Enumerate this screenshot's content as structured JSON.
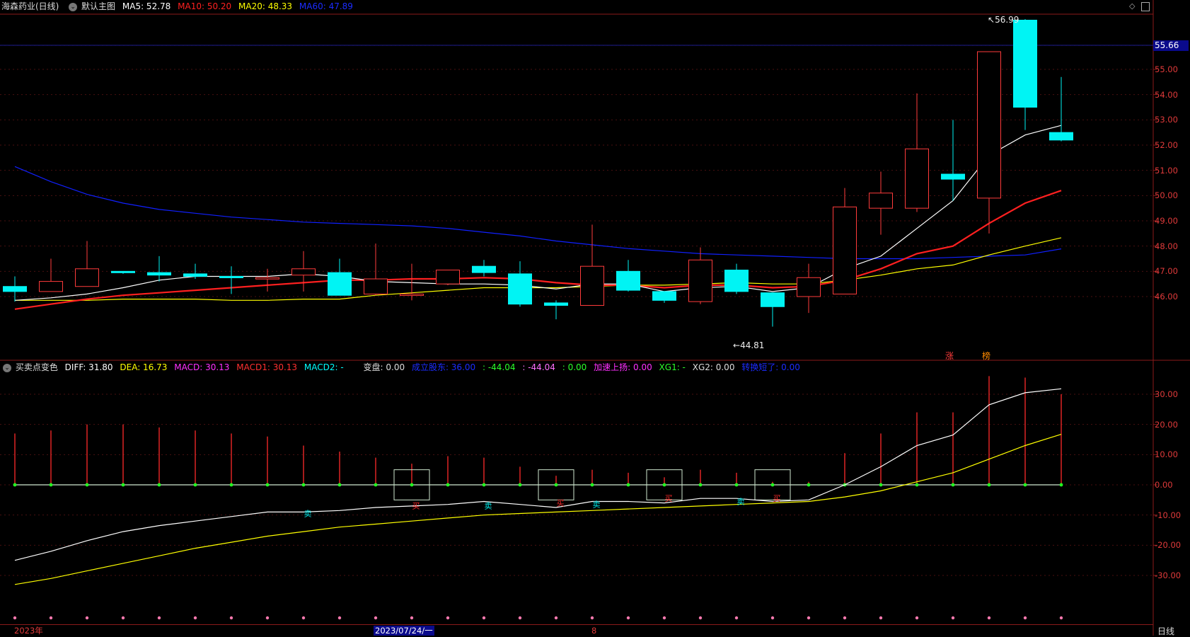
{
  "colors": {
    "up": "#ff3b3b",
    "down": "#00f4f4",
    "ma5": "#ffffff",
    "ma10": "#ff2020",
    "ma20": "#ffff00",
    "ma60": "#1020ff",
    "diff": "#ffffff",
    "dea": "#ffff00",
    "grid": "#8b1a1a"
  },
  "main": {
    "stock_name": "海森药业(日线)",
    "template": "默认主图",
    "ma5": "MA5: 52.78",
    "ma10": "MA10: 50.20",
    "ma20": "MA20: 48.33",
    "ma60": "MA60: 47.89",
    "high_marker": "56.99",
    "low_marker": "44.81",
    "current_price": "55.66",
    "signal_zhang": "涨",
    "signal_bang": "榜",
    "price_axis": [
      "55.00",
      "54.00",
      "53.00",
      "52.00",
      "51.00",
      "50.00",
      "49.00",
      "48.00",
      "47.00",
      "46.00"
    ]
  },
  "sub": {
    "indicator": "买卖点变色",
    "diff": "DIFF: 31.80",
    "dea": "DEA: 16.73",
    "macd": "MACD: 30.13",
    "macd1": "MACD1: 30.13",
    "macd2": "MACD2: -",
    "biangu": "变盘: 0.00",
    "chengli": "成立股东: 36.00",
    "v1": ": -44.04",
    "v2": ": -44.04",
    "v3": ": 0.00",
    "jiasu": "加速上扬: 0.00",
    "xg1": "XG1: -",
    "xg2": "XG2: 0.00",
    "zhuanshou": "转换短了: 0.00",
    "axis": [
      "30.00",
      "20.00",
      "10.00",
      "0.00",
      "-10.00",
      "-20.00",
      "-30.00"
    ],
    "buy_label": "买",
    "sell_label": "卖"
  },
  "dates": {
    "year": "2023年",
    "cursor": "2023/07/24/一",
    "month": "8"
  },
  "period": "日线",
  "chart_data": {
    "type": "candlestick",
    "candles": [
      {
        "o": 46.4,
        "c": 46.2,
        "h": 46.8,
        "l": 45.8
      },
      {
        "o": 46.2,
        "c": 46.6,
        "h": 47.5,
        "l": 46.2
      },
      {
        "o": 46.4,
        "c": 47.1,
        "h": 48.2,
        "l": 46.4
      },
      {
        "o": 47.0,
        "c": 46.96,
        "h": 47.0,
        "l": 46.9
      },
      {
        "o": 46.95,
        "c": 46.85,
        "h": 47.6,
        "l": 46.6
      },
      {
        "o": 46.9,
        "c": 46.8,
        "h": 47.3,
        "l": 46.7
      },
      {
        "o": 46.8,
        "c": 46.76,
        "h": 47.2,
        "l": 46.1
      },
      {
        "o": 46.75,
        "c": 46.75,
        "h": 47.1,
        "l": 46.2
      },
      {
        "o": 46.85,
        "c": 47.1,
        "h": 47.8,
        "l": 46.2
      },
      {
        "o": 46.95,
        "c": 46.05,
        "h": 47.5,
        "l": 46.05
      },
      {
        "o": 46.1,
        "c": 46.7,
        "h": 48.1,
        "l": 46.05
      },
      {
        "o": 46.1,
        "c": 46.1,
        "h": 47.3,
        "l": 45.85
      },
      {
        "o": 46.5,
        "c": 47.05,
        "h": 47.05,
        "l": 46.45
      },
      {
        "o": 47.2,
        "c": 46.95,
        "h": 47.45,
        "l": 46.8
      },
      {
        "o": 46.9,
        "c": 45.7,
        "h": 47.4,
        "l": 45.6
      },
      {
        "o": 45.75,
        "c": 45.65,
        "h": 45.85,
        "l": 45.1
      },
      {
        "o": 45.65,
        "c": 47.2,
        "h": 48.85,
        "l": 45.65
      },
      {
        "o": 47.0,
        "c": 46.25,
        "h": 47.45,
        "l": 46.2
      },
      {
        "o": 46.2,
        "c": 45.85,
        "h": 46.2,
        "l": 45.75
      },
      {
        "o": 45.8,
        "c": 47.45,
        "h": 47.95,
        "l": 45.7
      },
      {
        "o": 47.05,
        "c": 46.2,
        "h": 47.3,
        "l": 46.1
      },
      {
        "o": 46.15,
        "c": 45.6,
        "h": 46.15,
        "l": 44.81
      },
      {
        "o": 46.0,
        "c": 46.75,
        "h": 47.3,
        "l": 45.35
      },
      {
        "o": 46.1,
        "c": 49.55,
        "h": 50.3,
        "l": 46.1
      },
      {
        "o": 49.5,
        "c": 50.1,
        "h": 50.95,
        "l": 48.45
      },
      {
        "o": 49.5,
        "c": 51.85,
        "h": 54.05,
        "l": 49.35
      },
      {
        "o": 50.85,
        "c": 50.65,
        "h": 53.0,
        "l": 49.8
      },
      {
        "o": 49.9,
        "c": 55.7,
        "h": 55.7,
        "l": 48.5
      },
      {
        "o": 56.95,
        "c": 53.5,
        "h": 56.99,
        "l": 52.6
      },
      {
        "o": 52.5,
        "c": 52.2,
        "h": 54.7,
        "l": 52.15
      }
    ],
    "ma5": [
      45.85,
      45.95,
      46.1,
      46.35,
      46.65,
      46.8,
      46.8,
      46.8,
      46.9,
      46.8,
      46.6,
      46.55,
      46.5,
      46.5,
      46.45,
      46.3,
      46.5,
      46.5,
      46.2,
      46.35,
      46.4,
      46.2,
      46.35,
      47.1,
      47.6,
      48.7,
      49.8,
      51.6,
      52.4,
      52.78
    ],
    "ma10": [
      45.5,
      45.7,
      45.9,
      46.05,
      46.15,
      46.25,
      46.35,
      46.45,
      46.55,
      46.65,
      46.65,
      46.7,
      46.7,
      46.75,
      46.7,
      46.55,
      46.45,
      46.45,
      46.35,
      46.45,
      46.45,
      46.35,
      46.4,
      46.65,
      47.1,
      47.7,
      48.0,
      48.9,
      49.7,
      50.2
    ],
    "ma20": [
      45.85,
      45.85,
      45.85,
      45.9,
      45.9,
      45.9,
      45.85,
      45.85,
      45.9,
      45.9,
      46.05,
      46.15,
      46.25,
      46.35,
      46.35,
      46.35,
      46.4,
      46.45,
      46.45,
      46.5,
      46.55,
      46.5,
      46.5,
      46.65,
      46.85,
      47.1,
      47.25,
      47.65,
      48.0,
      48.33
    ],
    "ma60": [
      51.15,
      50.55,
      50.05,
      49.7,
      49.45,
      49.3,
      49.15,
      49.05,
      48.95,
      48.9,
      48.85,
      48.8,
      48.7,
      48.55,
      48.4,
      48.2,
      48.05,
      47.9,
      47.8,
      47.7,
      47.65,
      47.6,
      47.55,
      47.5,
      47.5,
      47.5,
      47.55,
      47.6,
      47.65,
      47.89
    ],
    "macd_bars": [
      17,
      18,
      20,
      20,
      19,
      18,
      17,
      16,
      13,
      11,
      9,
      7,
      9.5,
      9,
      6,
      3,
      5,
      4,
      2.5,
      5,
      4,
      1,
      1,
      10.5,
      17,
      24,
      24,
      36,
      35.5,
      30
    ],
    "diff": [
      -25,
      -22,
      -18.5,
      -15.5,
      -13.5,
      -12,
      -10.5,
      -9,
      -9,
      -8.5,
      -7.5,
      -7,
      -6.5,
      -5.5,
      -6.5,
      -7.5,
      -5.5,
      -5.5,
      -6,
      -4.5,
      -4.5,
      -5.5,
      -5,
      0,
      6,
      13,
      16.5,
      26.5,
      30.5,
      31.8
    ],
    "dea": [
      -33,
      -31,
      -28.5,
      -26,
      -23.5,
      -21,
      -19,
      -17,
      -15.5,
      -14,
      -13,
      -12,
      -11,
      -10,
      -9.5,
      -9,
      -8.5,
      -8,
      -7.5,
      -7,
      -6.5,
      -6,
      -5.5,
      -4,
      -2,
      1,
      4,
      8.5,
      13,
      16.73
    ],
    "signal_boxes": [
      11,
      15,
      18,
      21
    ],
    "buy_sell_marks": [
      {
        "i": 8,
        "t": "卖",
        "y": -9
      },
      {
        "i": 11,
        "t": "买",
        "y": -6.5
      },
      {
        "i": 13,
        "t": "卖",
        "y": -6.5
      },
      {
        "i": 15,
        "t": "买",
        "y": -5.5
      },
      {
        "i": 16,
        "t": "卖",
        "y": -6
      },
      {
        "i": 18,
        "t": "买",
        "y": -4
      },
      {
        "i": 20,
        "t": "卖",
        "y": -5
      },
      {
        "i": 21,
        "t": "买",
        "y": -4
      }
    ]
  }
}
